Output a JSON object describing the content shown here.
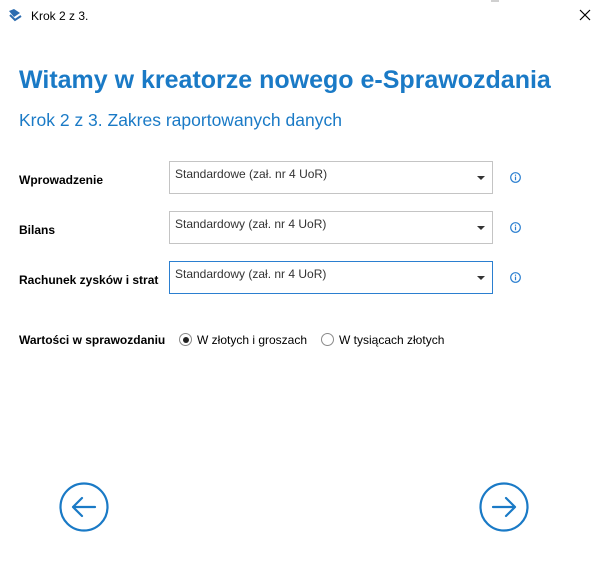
{
  "window": {
    "title": "Krok 2 z 3."
  },
  "header": {
    "title": "Witamy w kreatorze nowego e-Sprawozdania",
    "subtitle": "Krok 2 z 3. Zakres raportowanych danych"
  },
  "form": {
    "rows": [
      {
        "label": "Wprowadzenie",
        "value": "Standardowe (zał. nr 4 UoR)"
      },
      {
        "label": "Bilans",
        "value": "Standardowy (zał. nr 4 UoR)"
      },
      {
        "label": "Rachunek zysków i strat",
        "value": "Standardowy (zał. nr 4 UoR)"
      }
    ],
    "values": {
      "label": "Wartości w sprawozdaniu",
      "options": [
        {
          "label": "W złotych i groszach",
          "selected": true
        },
        {
          "label": "W tysiącach złotych",
          "selected": false
        }
      ]
    }
  },
  "icons": {
    "app": "app-logo-icon",
    "close": "close-icon",
    "info": "info-icon",
    "back": "arrow-left-circle-icon",
    "next": "arrow-right-circle-icon"
  },
  "colors": {
    "accent": "#1a7ac6",
    "focus_border": "#2b7fd0"
  }
}
